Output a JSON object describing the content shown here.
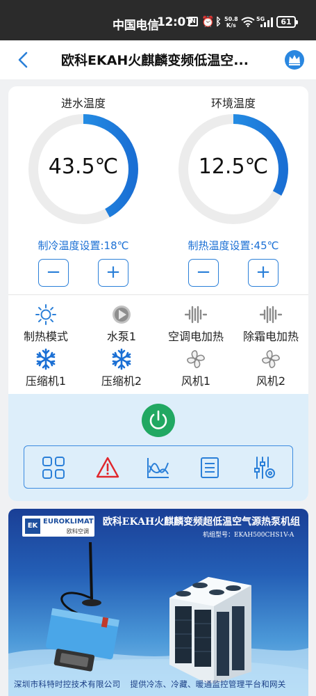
{
  "status_bar": {
    "carrier": "中国电信",
    "time": "12:07",
    "net_speed_value": "50.8",
    "net_speed_unit": "K/s",
    "signal_label": "5G",
    "battery": "61"
  },
  "nav": {
    "title": "欧科EKAH火麒麟变频低温空..."
  },
  "gauges": [
    {
      "label": "进水温度",
      "value": "43.5℃",
      "fill_fraction": 0.42,
      "setting_label": "制冷温度设置:18℃"
    },
    {
      "label": "环境温度",
      "value": "12.5℃",
      "fill_fraction": 0.33,
      "setting_label": "制热温度设置:45℃"
    }
  ],
  "stepper": {
    "minus": "−",
    "plus": "+"
  },
  "status_items": [
    {
      "label": "制热模式",
      "icon": "sun-icon"
    },
    {
      "label": "水泵1",
      "icon": "pump-icon"
    },
    {
      "label": "空调电加热",
      "icon": "heater-icon"
    },
    {
      "label": "除霜电加热",
      "icon": "heater-icon"
    },
    {
      "label": "压缩机1",
      "icon": "snowflake-icon"
    },
    {
      "label": "压缩机2",
      "icon": "snowflake-icon"
    },
    {
      "label": "风机1",
      "icon": "fan-icon"
    },
    {
      "label": "风机2",
      "icon": "fan-icon"
    }
  ],
  "toolbar": [
    {
      "icon": "grid-icon"
    },
    {
      "icon": "alarm-icon"
    },
    {
      "icon": "curve-chart-icon"
    },
    {
      "icon": "list-icon"
    },
    {
      "icon": "settings-sliders-icon"
    }
  ],
  "banner": {
    "logo_ek": "EK",
    "logo_brand": "EUROKLIMAT",
    "logo_brand_cn": "欧科空调",
    "title": "欧科EKAH火麒麟变频超低温空气源热泵机组",
    "model": "机组型号：EKAH500CHS1V-A",
    "footer_left": "深圳市科特时控技术有限公司",
    "footer_right": "提供冷冻、冷藏、暖通监控管理平台和网关"
  },
  "colors": {
    "accent_blue": "#2a7fd8",
    "gauge_start": "#2ea8f2",
    "gauge_end": "#1a6fd4",
    "power_green": "#21a862",
    "alarm_red": "#e0262c"
  }
}
